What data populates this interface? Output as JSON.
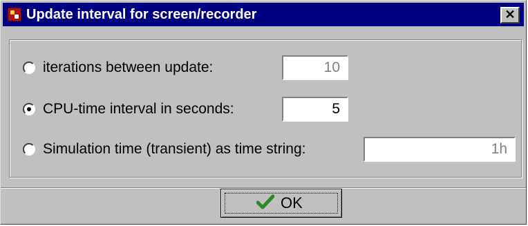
{
  "window": {
    "title": "Update interval for screen/recorder",
    "close_label": "✕"
  },
  "options": [
    {
      "label": "iterations between update:",
      "value": "10",
      "selected": false,
      "field_enabled": false
    },
    {
      "label": "CPU-time interval in seconds:",
      "value": "5",
      "selected": true,
      "field_enabled": true
    },
    {
      "label": "Simulation time (transient) as time string:",
      "value": "1h",
      "selected": false,
      "field_enabled": false
    }
  ],
  "buttons": {
    "ok_label": "OK"
  },
  "colors": {
    "titlebar": "#000080",
    "dialog_bg": "#c0c0c0",
    "check_icon": "#2a8a2a"
  }
}
